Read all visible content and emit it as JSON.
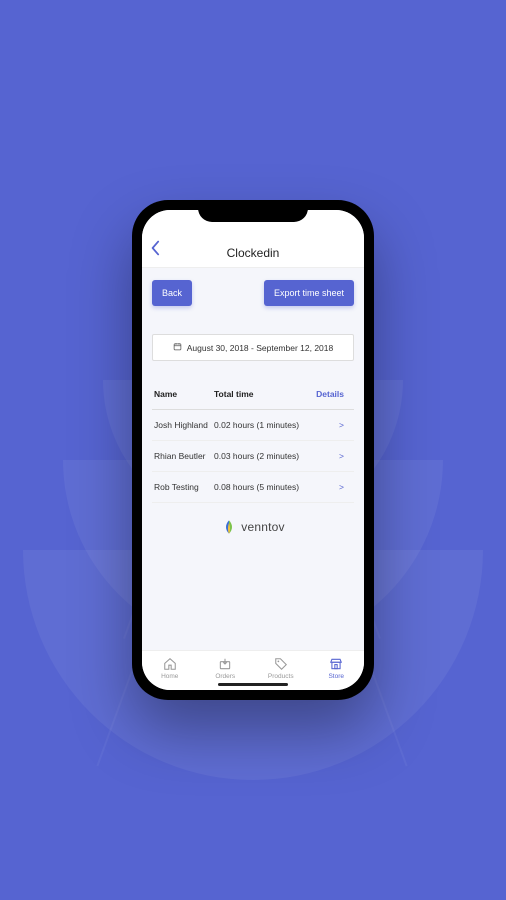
{
  "header": {
    "title": "Clockedin"
  },
  "toolbar": {
    "back_label": "Back",
    "export_label": "Export time sheet"
  },
  "date_range": {
    "text": "August 30, 2018 - September 12, 2018"
  },
  "table": {
    "headers": {
      "name": "Name",
      "time": "Total time",
      "details": "Details"
    },
    "rows": [
      {
        "name": "Josh Highland",
        "time": "0.02 hours (1 minutes)",
        "details": ">"
      },
      {
        "name": "Rhian Beutler",
        "time": "0.03 hours (2 minutes)",
        "details": ">"
      },
      {
        "name": "Rob Testing",
        "time": "0.08 hours (5 minutes)",
        "details": ">"
      }
    ]
  },
  "brand": {
    "name": "venntov"
  },
  "tabs": {
    "home": "Home",
    "orders": "Orders",
    "products": "Products",
    "store": "Store"
  },
  "colors": {
    "accent": "#5664d1"
  }
}
